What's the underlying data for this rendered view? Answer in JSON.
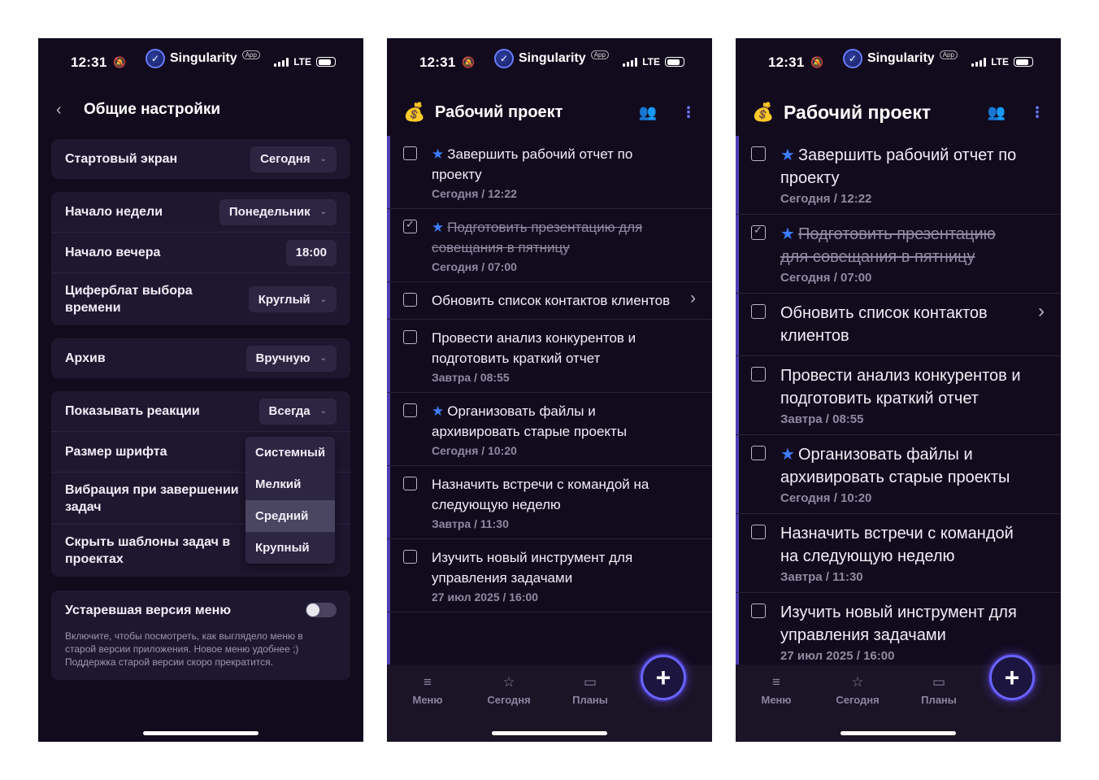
{
  "status": {
    "time": "12:31",
    "app_name": "Singularity",
    "app_tag": "App",
    "network": "LTE"
  },
  "settings": {
    "title": "Общие настройки",
    "start_screen": {
      "label": "Стартовый экран",
      "value": "Сегодня"
    },
    "week_start": {
      "label": "Начало недели",
      "value": "Понедельник"
    },
    "evening_start": {
      "label": "Начало вечера",
      "value": "18:00"
    },
    "dial": {
      "label": "Циферблат выбора времени",
      "value": "Круглый"
    },
    "archive": {
      "label": "Архив",
      "value": "Вручную"
    },
    "reactions": {
      "label": "Показывать реакции",
      "value": "Всегда"
    },
    "font_size": {
      "label": "Размер шрифта"
    },
    "vibration": {
      "label": "Вибрация при завершении задач"
    },
    "hide_templates": {
      "label": "Скрыть шаблоны задач в проектах"
    },
    "legacy_menu": {
      "label": "Устаревшая версия меню",
      "enabled": false,
      "hint": "Включите, чтобы посмотреть, как выглядело меню в старой версии приложения. Новое меню удобнее ;) Поддержка старой версии скоро прекратится."
    },
    "font_dropdown": [
      "Системный",
      "Мелкий",
      "Средний",
      "Крупный"
    ],
    "font_dropdown_highlight": "Средний"
  },
  "project": {
    "title": "Рабочий проект",
    "tasks": [
      {
        "title": "Завершить рабочий отчет по проекту",
        "date": "Сегодня / 12:22",
        "starred": true,
        "done": false
      },
      {
        "title": "Подготовить презентацию для совещания в пятницу",
        "date": "Сегодня / 07:00",
        "starred": true,
        "done": true
      },
      {
        "title": "Обновить список контактов клиентов",
        "date": "",
        "starred": false,
        "done": false,
        "has_subtasks": true
      },
      {
        "title": "Провести анализ конкурентов и подготовить краткий отчет",
        "date": "Завтра / 08:55",
        "starred": false,
        "done": false
      },
      {
        "title": "Организовать файлы и архивировать старые проекты",
        "date": "Сегодня / 10:20",
        "starred": true,
        "done": false
      },
      {
        "title": "Назначить встречи с командой на следующую неделю",
        "date": "Завтра / 11:30",
        "starred": false,
        "done": false
      },
      {
        "title": "Изучить новый инструмент для управления задачами",
        "date": "27 июл 2025 / 16:00",
        "starred": false,
        "done": false
      }
    ]
  },
  "nav": {
    "menu": "Меню",
    "today": "Сегодня",
    "plans": "Планы",
    "fab": "+"
  },
  "colors": {
    "background": "#120b1e",
    "card": "#1e1730",
    "accent": "#6a64ff",
    "star": "#3d7dff"
  }
}
